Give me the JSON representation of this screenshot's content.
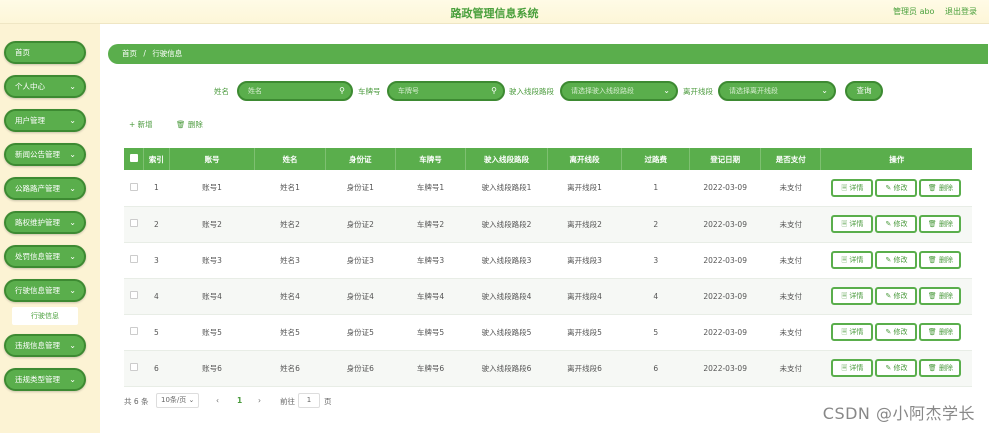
{
  "header": {
    "title": "路政管理信息系统",
    "user": "管理员 abo",
    "logout": "退出登录"
  },
  "sidebar": {
    "items": [
      {
        "label": "首页",
        "chevron": ""
      },
      {
        "label": "个人中心",
        "chevron": "⌄"
      },
      {
        "label": "用户管理",
        "chevron": "⌄"
      },
      {
        "label": "新闻公告管理",
        "chevron": "⌄"
      },
      {
        "label": "公路路产管理",
        "chevron": "⌄"
      },
      {
        "label": "路权维护管理",
        "chevron": "⌄"
      },
      {
        "label": "处罚信息管理",
        "chevron": "⌄"
      },
      {
        "label": "行驶信息管理",
        "chevron": "⌄"
      },
      {
        "label": "违规信息管理",
        "chevron": "⌄"
      },
      {
        "label": "违规类型管理",
        "chevron": "⌄"
      }
    ],
    "sub_item": "行驶信息"
  },
  "breadcrumb": {
    "home": "首页",
    "sep": "/",
    "current": "行驶信息"
  },
  "search": {
    "name_label": "姓名",
    "name_placeholder": "姓名",
    "plate_label": "车牌号",
    "plate_placeholder": "车牌号",
    "entry_label": "驶入线段路段",
    "entry_placeholder": "请选择驶入线段路段",
    "exit_label": "离开线段",
    "exit_placeholder": "请选择离开线段",
    "query_button": "查询",
    "search_icon": "magnifier-icon",
    "dropdown_icon": "chevron-down-icon"
  },
  "actions": {
    "add": "+ 新增",
    "delete": "🗑 删除"
  },
  "table": {
    "columns": [
      "索引",
      "账号",
      "姓名",
      "身份证",
      "车牌号",
      "驶入线段路段",
      "离开线段",
      "过路费",
      "登记日期",
      "是否支付",
      "操作"
    ],
    "rows": [
      {
        "index": "1",
        "account": "账号1",
        "name": "姓名1",
        "id_card": "身份证1",
        "plate": "车牌号1",
        "entry": "驶入线段路段1",
        "exit": "离开线段1",
        "toll": "1",
        "date": "2022-03-09",
        "paid": "未支付"
      },
      {
        "index": "2",
        "account": "账号2",
        "name": "姓名2",
        "id_card": "身份证2",
        "plate": "车牌号2",
        "entry": "驶入线段路段2",
        "exit": "离开线段2",
        "toll": "2",
        "date": "2022-03-09",
        "paid": "未支付"
      },
      {
        "index": "3",
        "account": "账号3",
        "name": "姓名3",
        "id_card": "身份证3",
        "plate": "车牌号3",
        "entry": "驶入线段路段3",
        "exit": "离开线段3",
        "toll": "3",
        "date": "2022-03-09",
        "paid": "未支付"
      },
      {
        "index": "4",
        "account": "账号4",
        "name": "姓名4",
        "id_card": "身份证4",
        "plate": "车牌号4",
        "entry": "驶入线段路段4",
        "exit": "离开线段4",
        "toll": "4",
        "date": "2022-03-09",
        "paid": "未支付"
      },
      {
        "index": "5",
        "account": "账号5",
        "name": "姓名5",
        "id_card": "身份证5",
        "plate": "车牌号5",
        "entry": "驶入线段路段5",
        "exit": "离开线段5",
        "toll": "5",
        "date": "2022-03-09",
        "paid": "未支付"
      },
      {
        "index": "6",
        "account": "账号6",
        "name": "姓名6",
        "id_card": "身份证6",
        "plate": "车牌号6",
        "entry": "驶入线段路段6",
        "exit": "离开线段6",
        "toll": "6",
        "date": "2022-03-09",
        "paid": "未支付"
      }
    ],
    "ops": {
      "detail": "🗏 详情",
      "edit": "✎ 修改",
      "delete": "🗑 删除"
    }
  },
  "pagination": {
    "total": "共 6 条",
    "page_size": "10条/页 ⌄",
    "prev": "‹",
    "current": "1",
    "next": "›",
    "goto": "前往",
    "goto_value": "1",
    "page_unit": "页"
  },
  "watermark": "CSDN @小阿杰学长",
  "colors": {
    "accent": "#5aae4c",
    "accent_dark": "#3d8a32",
    "sidebar_bg": "#fcf3d4"
  }
}
